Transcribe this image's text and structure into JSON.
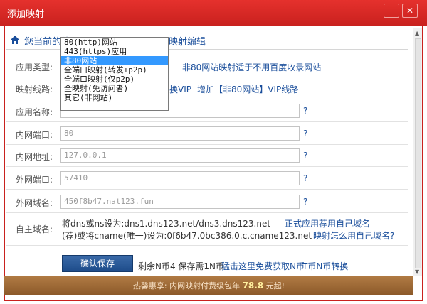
{
  "window": {
    "title": "添加映射",
    "minimize_glyph": "—",
    "close_glyph": "✕"
  },
  "breadcrumb": {
    "prefix": "您当前的位",
    "tail": "映射编辑"
  },
  "form": {
    "app_type": {
      "label": "应用类型:",
      "note": "非80网站映射适于不用百度收录网站",
      "options": [
        "80(http)网站",
        "443(https)应用",
        "非80网站",
        "全端口映射(转发+p2p)",
        "全端口映射(仅p2p)",
        "全映射(免访问者)",
        "其它(非网站)"
      ],
      "selected": "非80网站"
    },
    "line": {
      "label": "映射线路:",
      "link1": "换VIP",
      "link2": "增加【非80网站】VIP线路"
    },
    "app_name": {
      "label": "应用名称:",
      "value": ""
    },
    "internal_port": {
      "label": "内网端口:",
      "value": "80"
    },
    "internal_addr": {
      "label": "内网地址:",
      "value": "127.0.0.1"
    },
    "external_port": {
      "label": "外网端口:",
      "value": "57410"
    },
    "external_domain": {
      "label": "外网域名:",
      "value": "450f8b47.nat123.fun"
    },
    "own_domain": {
      "label": "自主域名:",
      "line1": "将dns或ns设为:dns1.dns123.net/dns3.dns123.net",
      "line1_link": "正式应用荐用自己域名",
      "line2": "(荐)或将cname(唯一)设为:0f6b47.0bc386.0.c.cname123.net",
      "line2_link": "映射怎么用自己域名?"
    },
    "help_glyph": "?"
  },
  "actions": {
    "save_label": "确认保存",
    "remaining": "剩余N币4 保存需1N币",
    "earn_link": "猛击这里免费获取N币",
    "convert_link": "T币N币转换"
  },
  "footer": {
    "prefix": "热馨惠享:  内网映射付费级包年",
    "price": "78.8",
    "suffix": "元起!"
  },
  "colors": {
    "titlebar": "#c9211e",
    "link": "#1a4e9b",
    "save": "#1e4c8a",
    "footer": "#9a6733"
  }
}
